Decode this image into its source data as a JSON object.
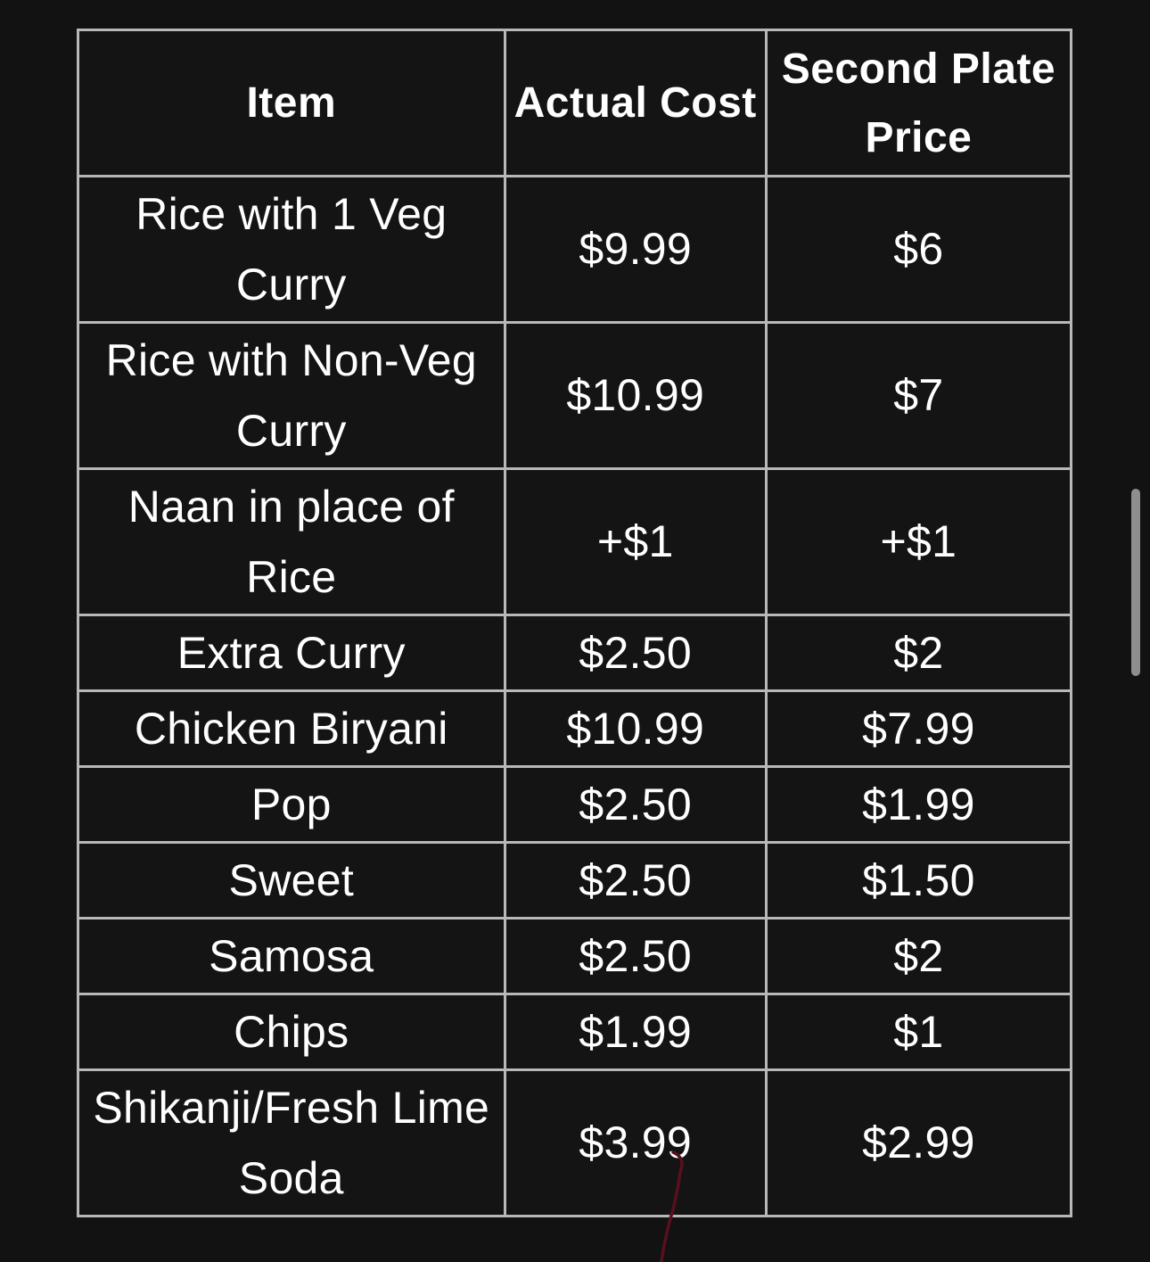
{
  "table": {
    "headers": {
      "item": "Item",
      "actual_cost": "Actual Cost",
      "second_plate_price": "Second Plate Price"
    },
    "rows": [
      {
        "item": "Rice with 1 Veg Curry",
        "actual_cost": "$9.99",
        "second_plate_price": "$6"
      },
      {
        "item": "Rice with Non-Veg Curry",
        "actual_cost": "$10.99",
        "second_plate_price": "$7"
      },
      {
        "item": "Naan in place of Rice",
        "actual_cost": "+$1",
        "second_plate_price": "+$1"
      },
      {
        "item": "Extra Curry",
        "actual_cost": "$2.50",
        "second_plate_price": "$2"
      },
      {
        "item": "Chicken Biryani",
        "actual_cost": "$10.99",
        "second_plate_price": "$7.99"
      },
      {
        "item": "Pop",
        "actual_cost": "$2.50",
        "second_plate_price": "$1.99"
      },
      {
        "item": "Sweet",
        "actual_cost": "$2.50",
        "second_plate_price": "$1.50"
      },
      {
        "item": "Samosa",
        "actual_cost": "$2.50",
        "second_plate_price": "$2"
      },
      {
        "item": "Chips",
        "actual_cost": "$1.99",
        "second_plate_price": "$1"
      },
      {
        "item": "Shikanji/Fresh Lime Soda",
        "actual_cost": "$3.99",
        "second_plate_price": "$2.99"
      }
    ]
  },
  "colors": {
    "background": "#121212",
    "border": "#b8b8b8",
    "text": "#ffffff",
    "scrollbar": "#8e8e8e",
    "pen_mark": "#5a0f1e"
  }
}
